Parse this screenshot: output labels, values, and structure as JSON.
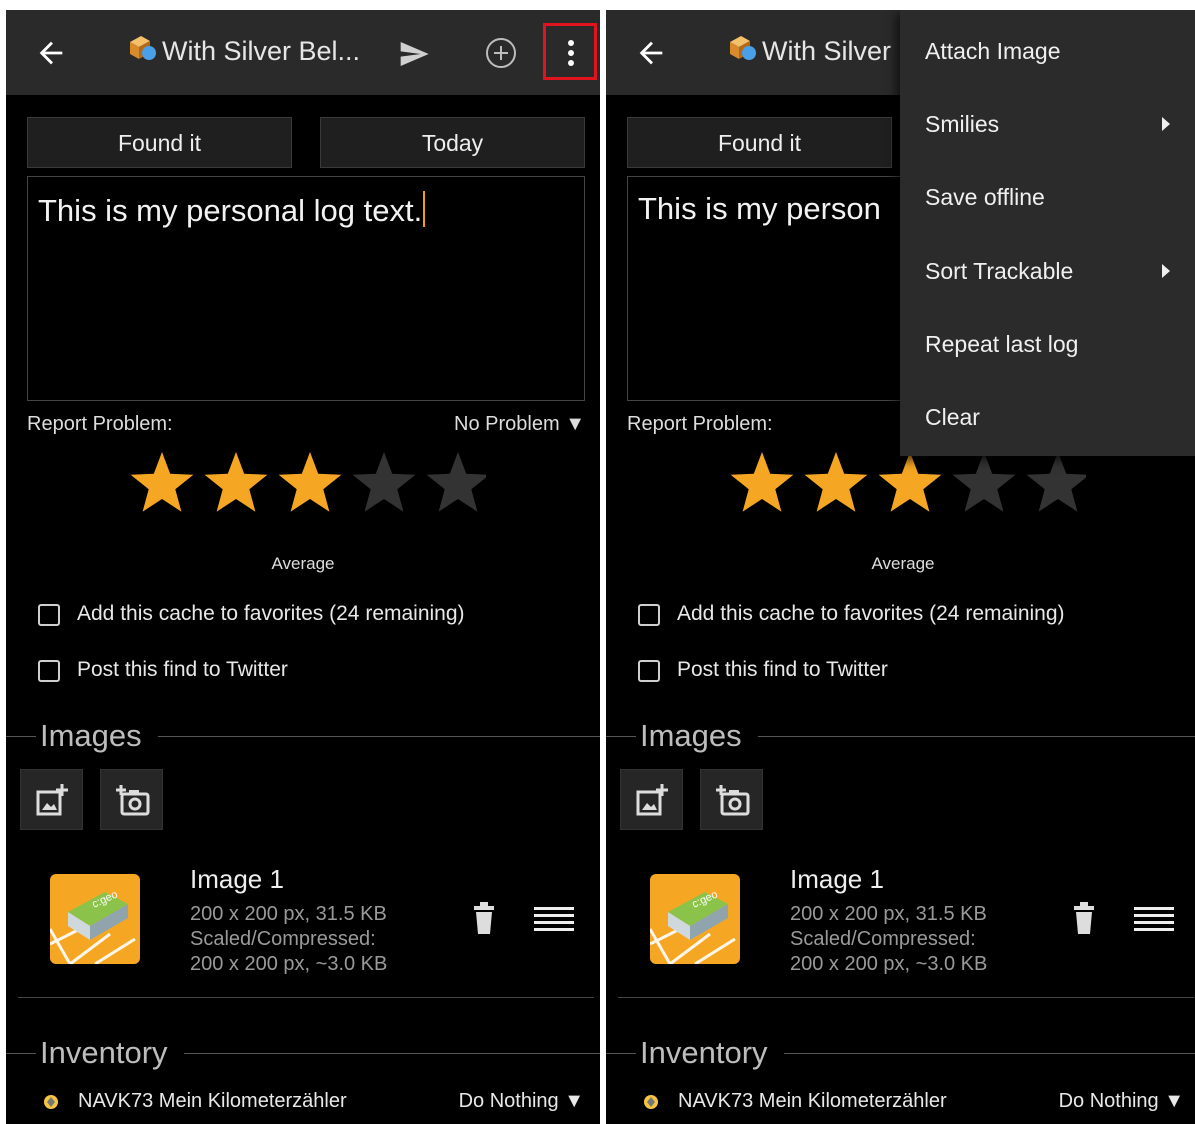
{
  "screens": [
    {
      "appbar": {
        "title": "With Silver Bel..."
      },
      "buttons": {
        "log_type": "Found it",
        "date": "Today"
      },
      "log_text": "This is my personal log text.",
      "report_problem": {
        "label": "Report Problem:",
        "value": "No Problem ▼"
      },
      "rating": {
        "filled_stars": 3,
        "total_stars": 5,
        "label": "Average"
      },
      "checkboxes": {
        "favorites": "Add this cache to favorites (24 remaining)",
        "twitter": "Post this find to Twitter"
      },
      "images": {
        "section_title": "Images",
        "item": {
          "title": "Image 1",
          "line1": "200 x 200 px, 31.5 KB",
          "line2": "Scaled/Compressed:",
          "line3": "200 x 200 px, ~3.0 KB",
          "thumb_text": "c:geo"
        }
      },
      "inventory": {
        "section_title": "Inventory",
        "item": {
          "name": "NAVK73 Mein Kilometerzähler",
          "action": "Do Nothing ▼"
        }
      }
    },
    {
      "appbar": {
        "title": "With Silver"
      },
      "buttons": {
        "log_type": "Found it"
      },
      "log_text": "This is my person",
      "report_problem": {
        "label": "Report Problem:"
      },
      "rating": {
        "filled_stars": 3,
        "total_stars": 5,
        "label": "Average"
      },
      "checkboxes": {
        "favorites": "Add this cache to favorites (24 remaining)",
        "twitter": "Post this find to Twitter"
      },
      "images": {
        "section_title": "Images",
        "item": {
          "title": "Image 1",
          "line1": "200 x 200 px, 31.5 KB",
          "line2": "Scaled/Compressed:",
          "line3": "200 x 200 px, ~3.0 KB",
          "thumb_text": "c:geo"
        }
      },
      "inventory": {
        "section_title": "Inventory",
        "item": {
          "name": "NAVK73 Mein Kilometerzähler",
          "action": "Do Nothing ▼"
        }
      },
      "overflow_menu": {
        "items": [
          {
            "label": "Attach Image",
            "submenu": false
          },
          {
            "label": "Smilies",
            "submenu": true
          },
          {
            "label": "Save offline",
            "submenu": false
          },
          {
            "label": "Sort Trackable",
            "submenu": true
          },
          {
            "label": "Repeat last log",
            "submenu": false
          },
          {
            "label": "Clear",
            "submenu": false
          }
        ]
      }
    }
  ],
  "colors": {
    "background": "#000000",
    "appbar": "#2a2a2a",
    "star_filled": "#f5a623",
    "star_empty": "#333333",
    "highlight": "#e0141e",
    "menu_bg": "#2b2b2b"
  },
  "icons": {
    "back": "arrow-left-icon",
    "cache": "cache-type-icon",
    "send": "send-icon",
    "add": "plus-circle-icon",
    "more": "more-vertical-icon",
    "gallery": "add-photo-icon",
    "camera": "camera-icon",
    "trash": "trash-icon",
    "menu": "reorder-icon",
    "trackable": "trackable-icon"
  }
}
